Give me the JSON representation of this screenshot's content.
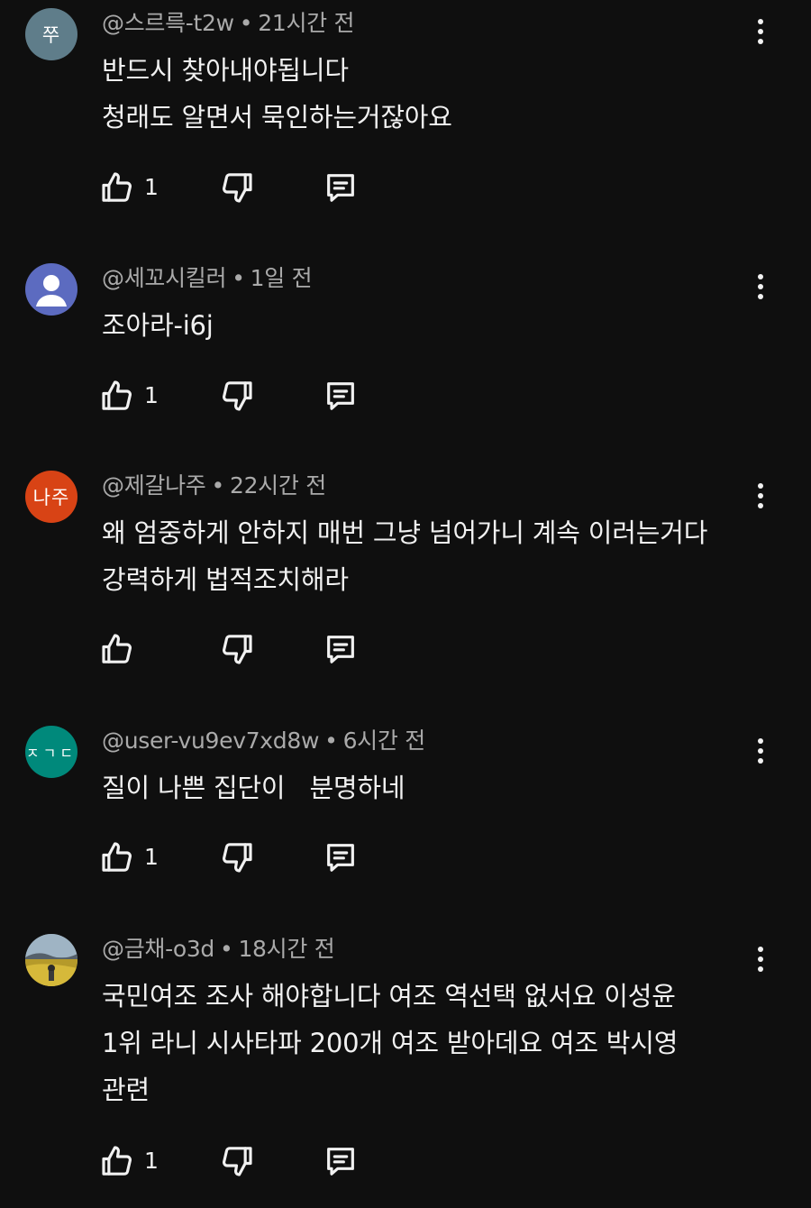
{
  "comments": [
    {
      "avatar": {
        "text": "쭈",
        "color": "#5f7d8a"
      },
      "author": "@스르륵-t2w",
      "time": "21시간 전",
      "lines": [
        "반드시 찾아내야됩니다",
        "청래도 알면서 묵인하는거잖아요"
      ],
      "likes": "1"
    },
    {
      "avatar": {
        "text": "",
        "color": "#5c6bc0",
        "icon": "person-icon"
      },
      "author": "@세꼬시킬러",
      "time": "1일 전",
      "lines": [
        "조아라-i6j"
      ],
      "likes": "1"
    },
    {
      "avatar": {
        "text": "나주",
        "color": "#d84315"
      },
      "author": "@제갈나주",
      "time": "22시간 전",
      "lines": [
        "왜 엄중하게 안하지 매번 그냥 넘어가니 계속 이러는거다",
        "강력하게 법적조치해라"
      ],
      "likes": ""
    },
    {
      "avatar": {
        "text": "ㅈㄱㄷ",
        "color": "#00897b"
      },
      "author": "@user-vu9ev7xd8w",
      "time": "6시간 전",
      "lines": [
        "질이 나쁜 집단이   분명하네"
      ],
      "likes": "1"
    },
    {
      "avatar": {
        "text": "",
        "color": "#6d7f8c",
        "icon": "landscape-photo"
      },
      "author": "@금채-o3d",
      "time": "18시간 전",
      "lines": [
        "국민여조 조사 해야합니다 여조 역선택 없서요 이성윤",
        "1위 라니 시사타파 200개 여조 받아데요 여조 박시영",
        "관련"
      ],
      "likes": "1"
    }
  ],
  "separator": "•",
  "icons": {
    "like": "thumb-up-icon",
    "dislike": "thumb-down-icon",
    "reply": "reply-comment-icon",
    "menu": "more-vert-icon"
  }
}
